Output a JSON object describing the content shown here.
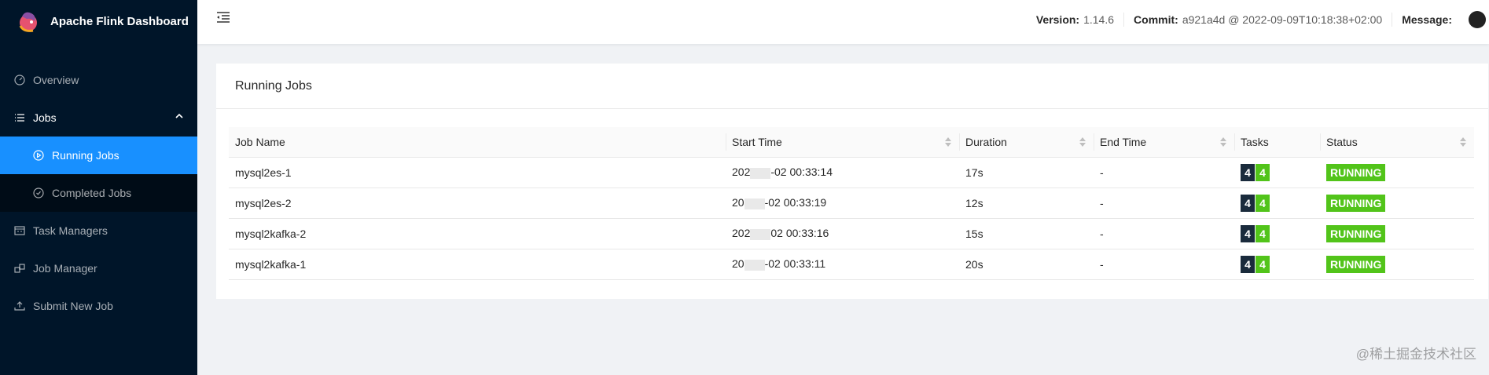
{
  "app": {
    "title": "Apache Flink Dashboard"
  },
  "sidebar": {
    "items": [
      {
        "label": "Overview",
        "icon": "dashboard-icon"
      },
      {
        "label": "Jobs",
        "icon": "list-icon"
      },
      {
        "label": "Running Jobs",
        "icon": "play-circle-icon",
        "active": true
      },
      {
        "label": "Completed Jobs",
        "icon": "check-circle-icon"
      },
      {
        "label": "Task Managers",
        "icon": "schedule-icon"
      },
      {
        "label": "Job Manager",
        "icon": "build-icon"
      },
      {
        "label": "Submit New Job",
        "icon": "upload-icon"
      }
    ]
  },
  "header": {
    "version_label": "Version:",
    "version": "1.14.6",
    "commit_label": "Commit:",
    "commit": "a921a4d @ 2022-09-09T10:18:38+02:00",
    "message_label": "Message:"
  },
  "card": {
    "title": "Running Jobs",
    "columns": [
      "Job Name",
      "Start Time",
      "Duration",
      "End Time",
      "Tasks",
      "Status"
    ],
    "rows": [
      {
        "name": "mysql2es-1",
        "start_prefix": "202",
        "start_suffix": "-02 00:33:14",
        "duration": "17s",
        "end": "-",
        "task_a": "4",
        "task_b": "4",
        "status": "RUNNING"
      },
      {
        "name": "mysql2es-2",
        "start_prefix": "20",
        "start_suffix": "-02 00:33:19",
        "duration": "12s",
        "end": "-",
        "task_a": "4",
        "task_b": "4",
        "status": "RUNNING"
      },
      {
        "name": "mysql2kafka-2",
        "start_prefix": "202",
        "start_suffix": "02 00:33:16",
        "duration": "15s",
        "end": "-",
        "task_a": "4",
        "task_b": "4",
        "status": "RUNNING"
      },
      {
        "name": "mysql2kafka-1",
        "start_prefix": "20",
        "start_suffix": "-02 00:33:11",
        "duration": "20s",
        "end": "-",
        "task_a": "4",
        "task_b": "4",
        "status": "RUNNING"
      }
    ]
  },
  "watermark": "@稀土掘金技术社区",
  "colors": {
    "sidebar_bg": "#001529",
    "active": "#1890ff",
    "running": "#52c41a"
  }
}
